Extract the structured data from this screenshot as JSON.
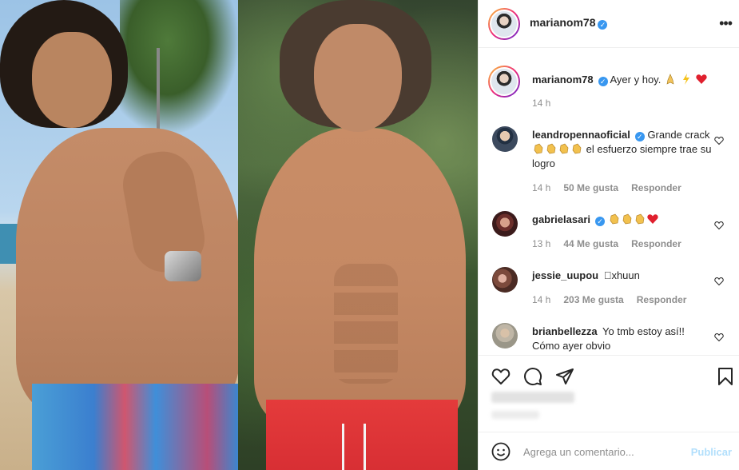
{
  "post": {
    "username": "marianom78",
    "verified": true,
    "caption": "Ayer y hoy.",
    "caption_emojis": [
      "folded-hands",
      "lightning",
      "red-heart"
    ],
    "time": "14 h"
  },
  "comments": [
    {
      "username": "leandropennaoficial",
      "verified": true,
      "text_before": "Grande crack",
      "emojis": [
        "clap",
        "clap",
        "clap",
        "clap"
      ],
      "text_after": "el esfuerzo siempre trae su logro",
      "time": "14 h",
      "likes": "50 Me gusta",
      "reply": "Responder"
    },
    {
      "username": "gabrielasari",
      "verified": true,
      "text_before": "",
      "emojis": [
        "clap",
        "clap",
        "clap",
        "red-heart"
      ],
      "text_after": "",
      "time": "13 h",
      "likes": "44 Me gusta",
      "reply": "Responder"
    },
    {
      "username": "jessie_uupou",
      "verified": false,
      "text_before": "\u0000xhuun",
      "emojis": [],
      "text_after": "",
      "time": "14 h",
      "likes": "203 Me gusta",
      "reply": "Responder"
    },
    {
      "username": "brianbellezza",
      "verified": false,
      "text_before": "Yo tmb estoy así!! Cómo ayer obvio",
      "emojis": [],
      "text_after": "",
      "time": "",
      "likes": "",
      "reply": ""
    }
  ],
  "actions": {
    "like_icon": "heart-icon",
    "comment_icon": "comment-icon",
    "share_icon": "share-icon",
    "save_icon": "bookmark-icon"
  },
  "add_comment": {
    "placeholder": "Agrega un comentario...",
    "publish_label": "Publicar"
  },
  "colors": {
    "verified_blue": "#3897f0",
    "publish_disabled": "#b2dffc",
    "muted_text": "#8e8e8e"
  }
}
